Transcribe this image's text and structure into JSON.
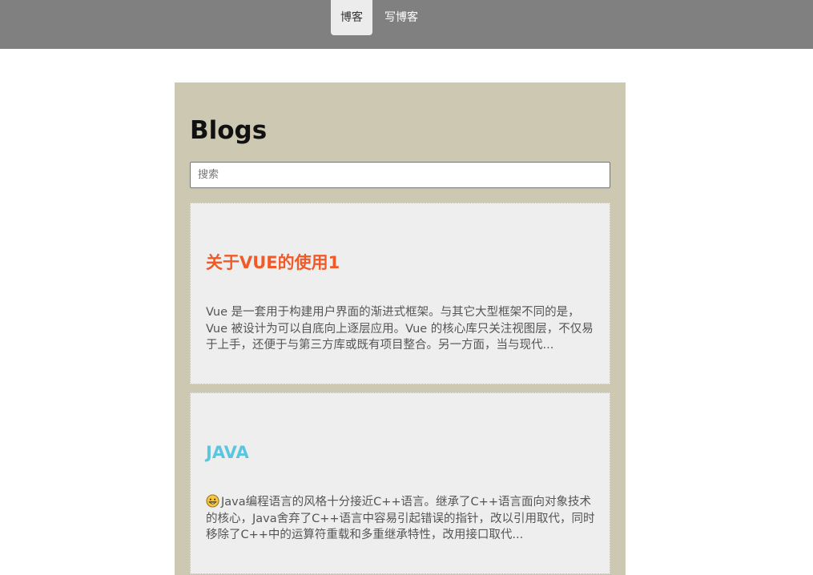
{
  "nav": {
    "items": [
      {
        "label": "博客",
        "active": true
      },
      {
        "label": "写博客",
        "active": false
      }
    ]
  },
  "page": {
    "heading": "Blogs",
    "search_placeholder": "搜索"
  },
  "posts": [
    {
      "title": "关于VUE的使用1",
      "title_color": "#f05a28",
      "excerpt": "Vue 是一套用于构建用户界面的渐进式框架。与其它大型框架不同的是，Vue 被设计为可以自底向上逐层应用。Vue 的核心库只关注视图层，不仅易于上手，还便于与第三方库或既有项目整合。另一方面，当与现代...",
      "icon": null
    },
    {
      "title": "JAVA",
      "title_color": "#5bc5de",
      "excerpt": "Java编程语言的风格十分接近C++语言。继承了C++语言面向对象技术的核心，Java舍弃了C++语言中容易引起错误的指针，改以引用取代，同时移除了C++中的运算符重载和多重继承特性，改用接口取代...",
      "icon": "grinning-emoji-icon"
    }
  ],
  "colors": {
    "navbar": "#808080",
    "panel": "#cdc8b1",
    "card": "#eeeeee"
  }
}
